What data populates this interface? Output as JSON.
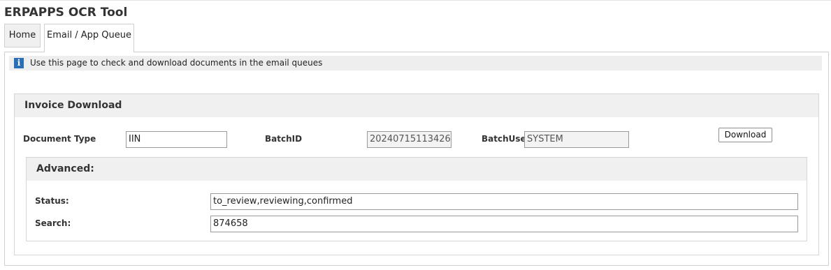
{
  "app": {
    "title": "ERPAPPS OCR Tool"
  },
  "tabs": [
    {
      "label": "Home",
      "active": false
    },
    {
      "label": "Email / App Queue",
      "active": true
    }
  ],
  "info": {
    "icon": "info-icon",
    "glyph": "i",
    "text": "Use this page to check and download documents in the email queues"
  },
  "invoice_download": {
    "title": "Invoice Download",
    "document_type": {
      "label": "Document Type",
      "value": "IIN"
    },
    "batch_id": {
      "label": "BatchID",
      "value": "20240715113426"
    },
    "batch_user": {
      "label": "BatchUser:",
      "value": "SYSTEM"
    },
    "download_label": "Download"
  },
  "advanced": {
    "title": "Advanced:",
    "status": {
      "label": "Status:",
      "value": "to_review,reviewing,confirmed"
    },
    "search": {
      "label": "Search:",
      "value": "874658"
    }
  },
  "colors": {
    "info_icon": "#2a6fb5",
    "header_bg": "#f0f0f0",
    "readonly_bg": "#f3f3f3"
  }
}
